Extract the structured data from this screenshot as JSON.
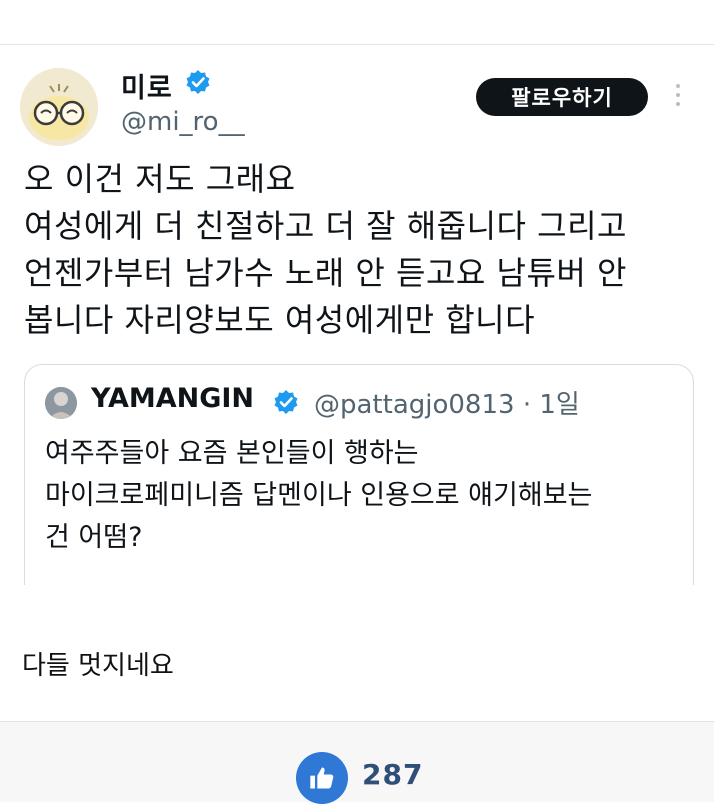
{
  "tweet": {
    "display_name": "미로",
    "handle": "@mi_ro__",
    "follow_label": "팔로우하기",
    "text_lines": [
      "오 이건 저도 그래요",
      "여성에게 더 친절하고 더 잘 해줍니다 그리고",
      "언젠가부터 남가수 노래 안 듣고요 남튜버 안",
      "봅니다 자리양보도 여성에게만 합니다"
    ]
  },
  "quote": {
    "name": "YAMANGIN",
    "handle_time": "@pattagjo0813 · 1일",
    "text_lines": [
      "여주주들아 요즘 본인들이 행하는",
      "마이크로페미니즘 답멘이나 인용으로 얘기해보는",
      "건 어떰?"
    ]
  },
  "comment": "다들 멋지네요",
  "likes": {
    "count": "287"
  },
  "colors": {
    "verified": "#1d9bf0",
    "follow_bg": "#0f1419",
    "like_bg": "#2f78d6",
    "like_count": "#2f4f78"
  },
  "icons": {
    "verified": "verified-badge-icon",
    "more": "more-options-icon",
    "like": "thumbs-up-icon"
  }
}
